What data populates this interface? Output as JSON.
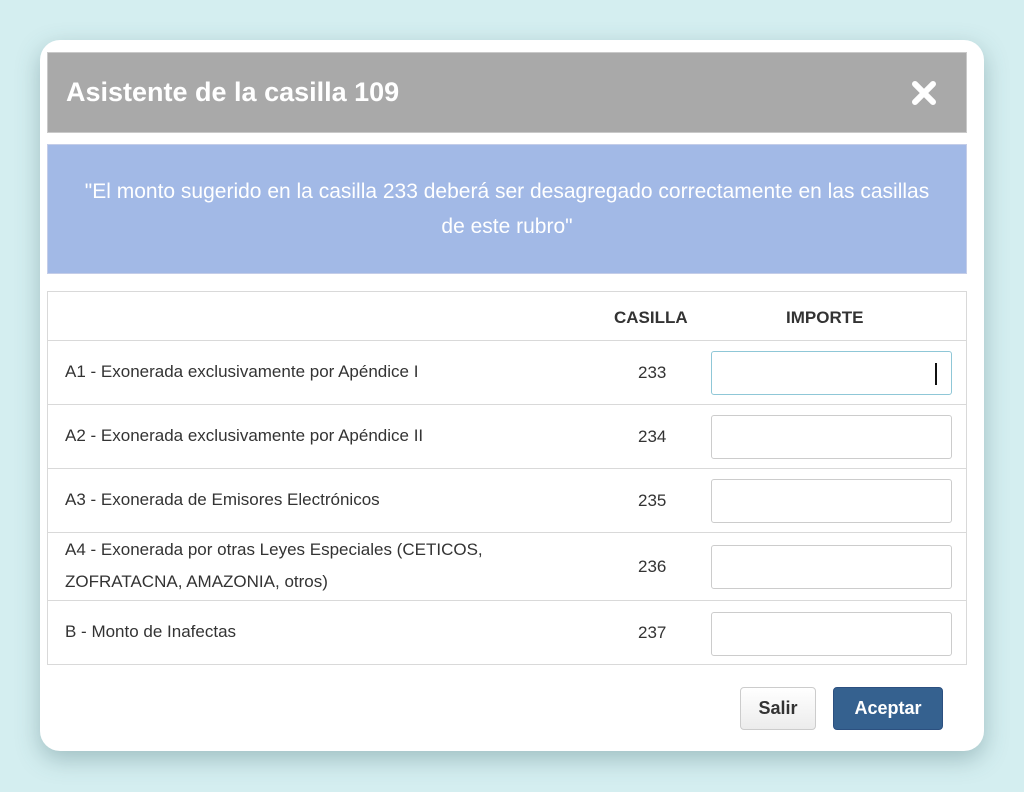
{
  "dialog": {
    "title": "Asistente de la casilla 109",
    "close_icon": "close-icon"
  },
  "banner": {
    "message": "\"El monto sugerido en la casilla 233 deberá ser desagregado correctamente en las casillas de este rubro\""
  },
  "table": {
    "headers": {
      "casilla": "CASILLA",
      "importe": "IMPORTE"
    },
    "rows": [
      {
        "label": "A1 - Exonerada exclusivamente por Apéndice I",
        "casilla": "233",
        "importe": "",
        "focused": true
      },
      {
        "label": "A2 - Exonerada exclusivamente por Apéndice II",
        "casilla": "234",
        "importe": ""
      },
      {
        "label": "A3 - Exonerada de Emisores Electrónicos",
        "casilla": "235",
        "importe": ""
      },
      {
        "label": "A4 - Exonerada por otras Leyes Especiales (CETICOS, ZOFRATACNA, AMAZONIA, otros)",
        "casilla": "236",
        "importe": ""
      },
      {
        "label": "B - Monto de Inafectas",
        "casilla": "237",
        "importe": ""
      }
    ]
  },
  "footer": {
    "salir_label": "Salir",
    "aceptar_label": "Aceptar"
  },
  "colors": {
    "header_bg": "#a9a9a9",
    "banner_bg": "#a2b9e6",
    "primary_button": "#35618f",
    "page_bg": "#d4eef0"
  }
}
